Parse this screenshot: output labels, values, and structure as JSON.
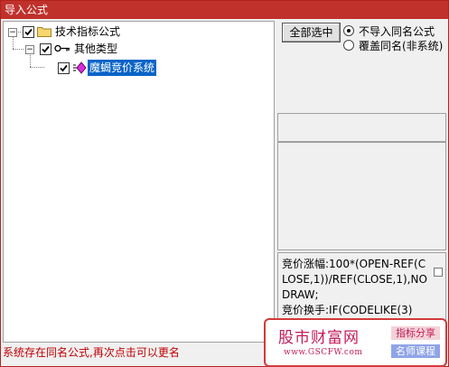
{
  "window": {
    "title": "导入公式"
  },
  "tree": {
    "root": {
      "label": "技术指标公式",
      "checked": true,
      "expanded": true
    },
    "child": {
      "label": "其他类型",
      "checked": true,
      "expanded": true
    },
    "leaf": {
      "label": "魔蝎竞价系统",
      "checked": true,
      "selected": true
    }
  },
  "actions": {
    "select_all_label": "全部选中"
  },
  "options": {
    "no_import_label": "不导入同名公式",
    "overwrite_label": "覆盖同名(非系统)",
    "selected": "no_import"
  },
  "preview": {
    "code": "竞价涨幅:100*(OPEN-REF(CLOSE,1))/REF(CLOSE,1),NODRAW;\n竞价换手:IF(CODELIKE(3)"
  },
  "status": {
    "message": "系统存在同名公式,再次点击可以更名"
  },
  "watermark": {
    "title": "股市财富网",
    "url": "www.GSCFW.com",
    "tag1": "指标分享",
    "tag2": "名师课程"
  },
  "colors": {
    "titlebar": "#c0312c",
    "selection": "#0a64c8",
    "status_text": "#c00000",
    "watermark_accent": "#c41c5a"
  }
}
